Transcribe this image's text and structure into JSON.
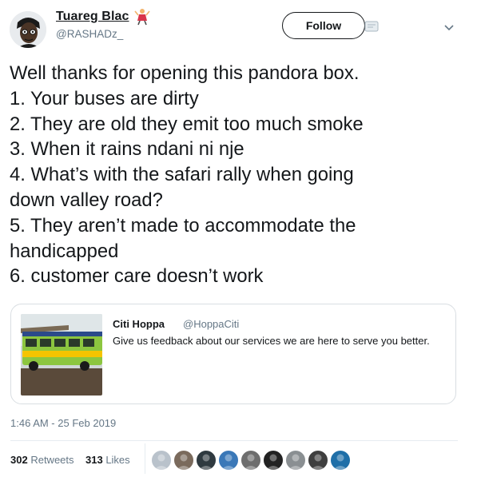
{
  "author": {
    "name": "Tuareg Blac",
    "handle": "@RASHADz_",
    "avatar_icon": "cartoon-portrait-avatar",
    "name_emoji": "woman-dancing-emoji"
  },
  "follow_button": {
    "label": "Follow"
  },
  "tweet": {
    "lines": [
      "Well thanks for opening this pandora box.",
      "1. Your buses are dirty",
      "2. They are old they emit too much smoke",
      "3. When it rains ndani ni nje",
      "4. What’s with the safari rally when going",
      "down valley road?",
      "5. They aren’t made to accommodate the",
      "handicapped",
      "6. customer care doesn’t work"
    ]
  },
  "quoted_tweet": {
    "name": "Citi Hoppa",
    "handle": "@HoppaCiti",
    "text": "Give us feedback about our services we are here to serve you better.",
    "image_desc": "green-and-yellow-bus-photo"
  },
  "timestamp": "1:46 AM - 25 Feb 2019",
  "stats": {
    "retweets_count": "302",
    "retweets_label": "Retweets",
    "likes_count": "313",
    "likes_label": "Likes"
  },
  "liker_avatars": [
    {
      "color": "#b9c2cb"
    },
    {
      "color": "#7a6a5c"
    },
    {
      "color": "#2f3a40"
    },
    {
      "color": "#3a78b8"
    },
    {
      "color": "#6e6e6e"
    },
    {
      "color": "#222222"
    },
    {
      "color": "#8a8f92"
    },
    {
      "color": "#3f3f3f"
    },
    {
      "color": "#1f6fa8"
    }
  ],
  "colors": {
    "text": "#14171a",
    "secondary": "#657786",
    "border": "#d9dee2"
  }
}
